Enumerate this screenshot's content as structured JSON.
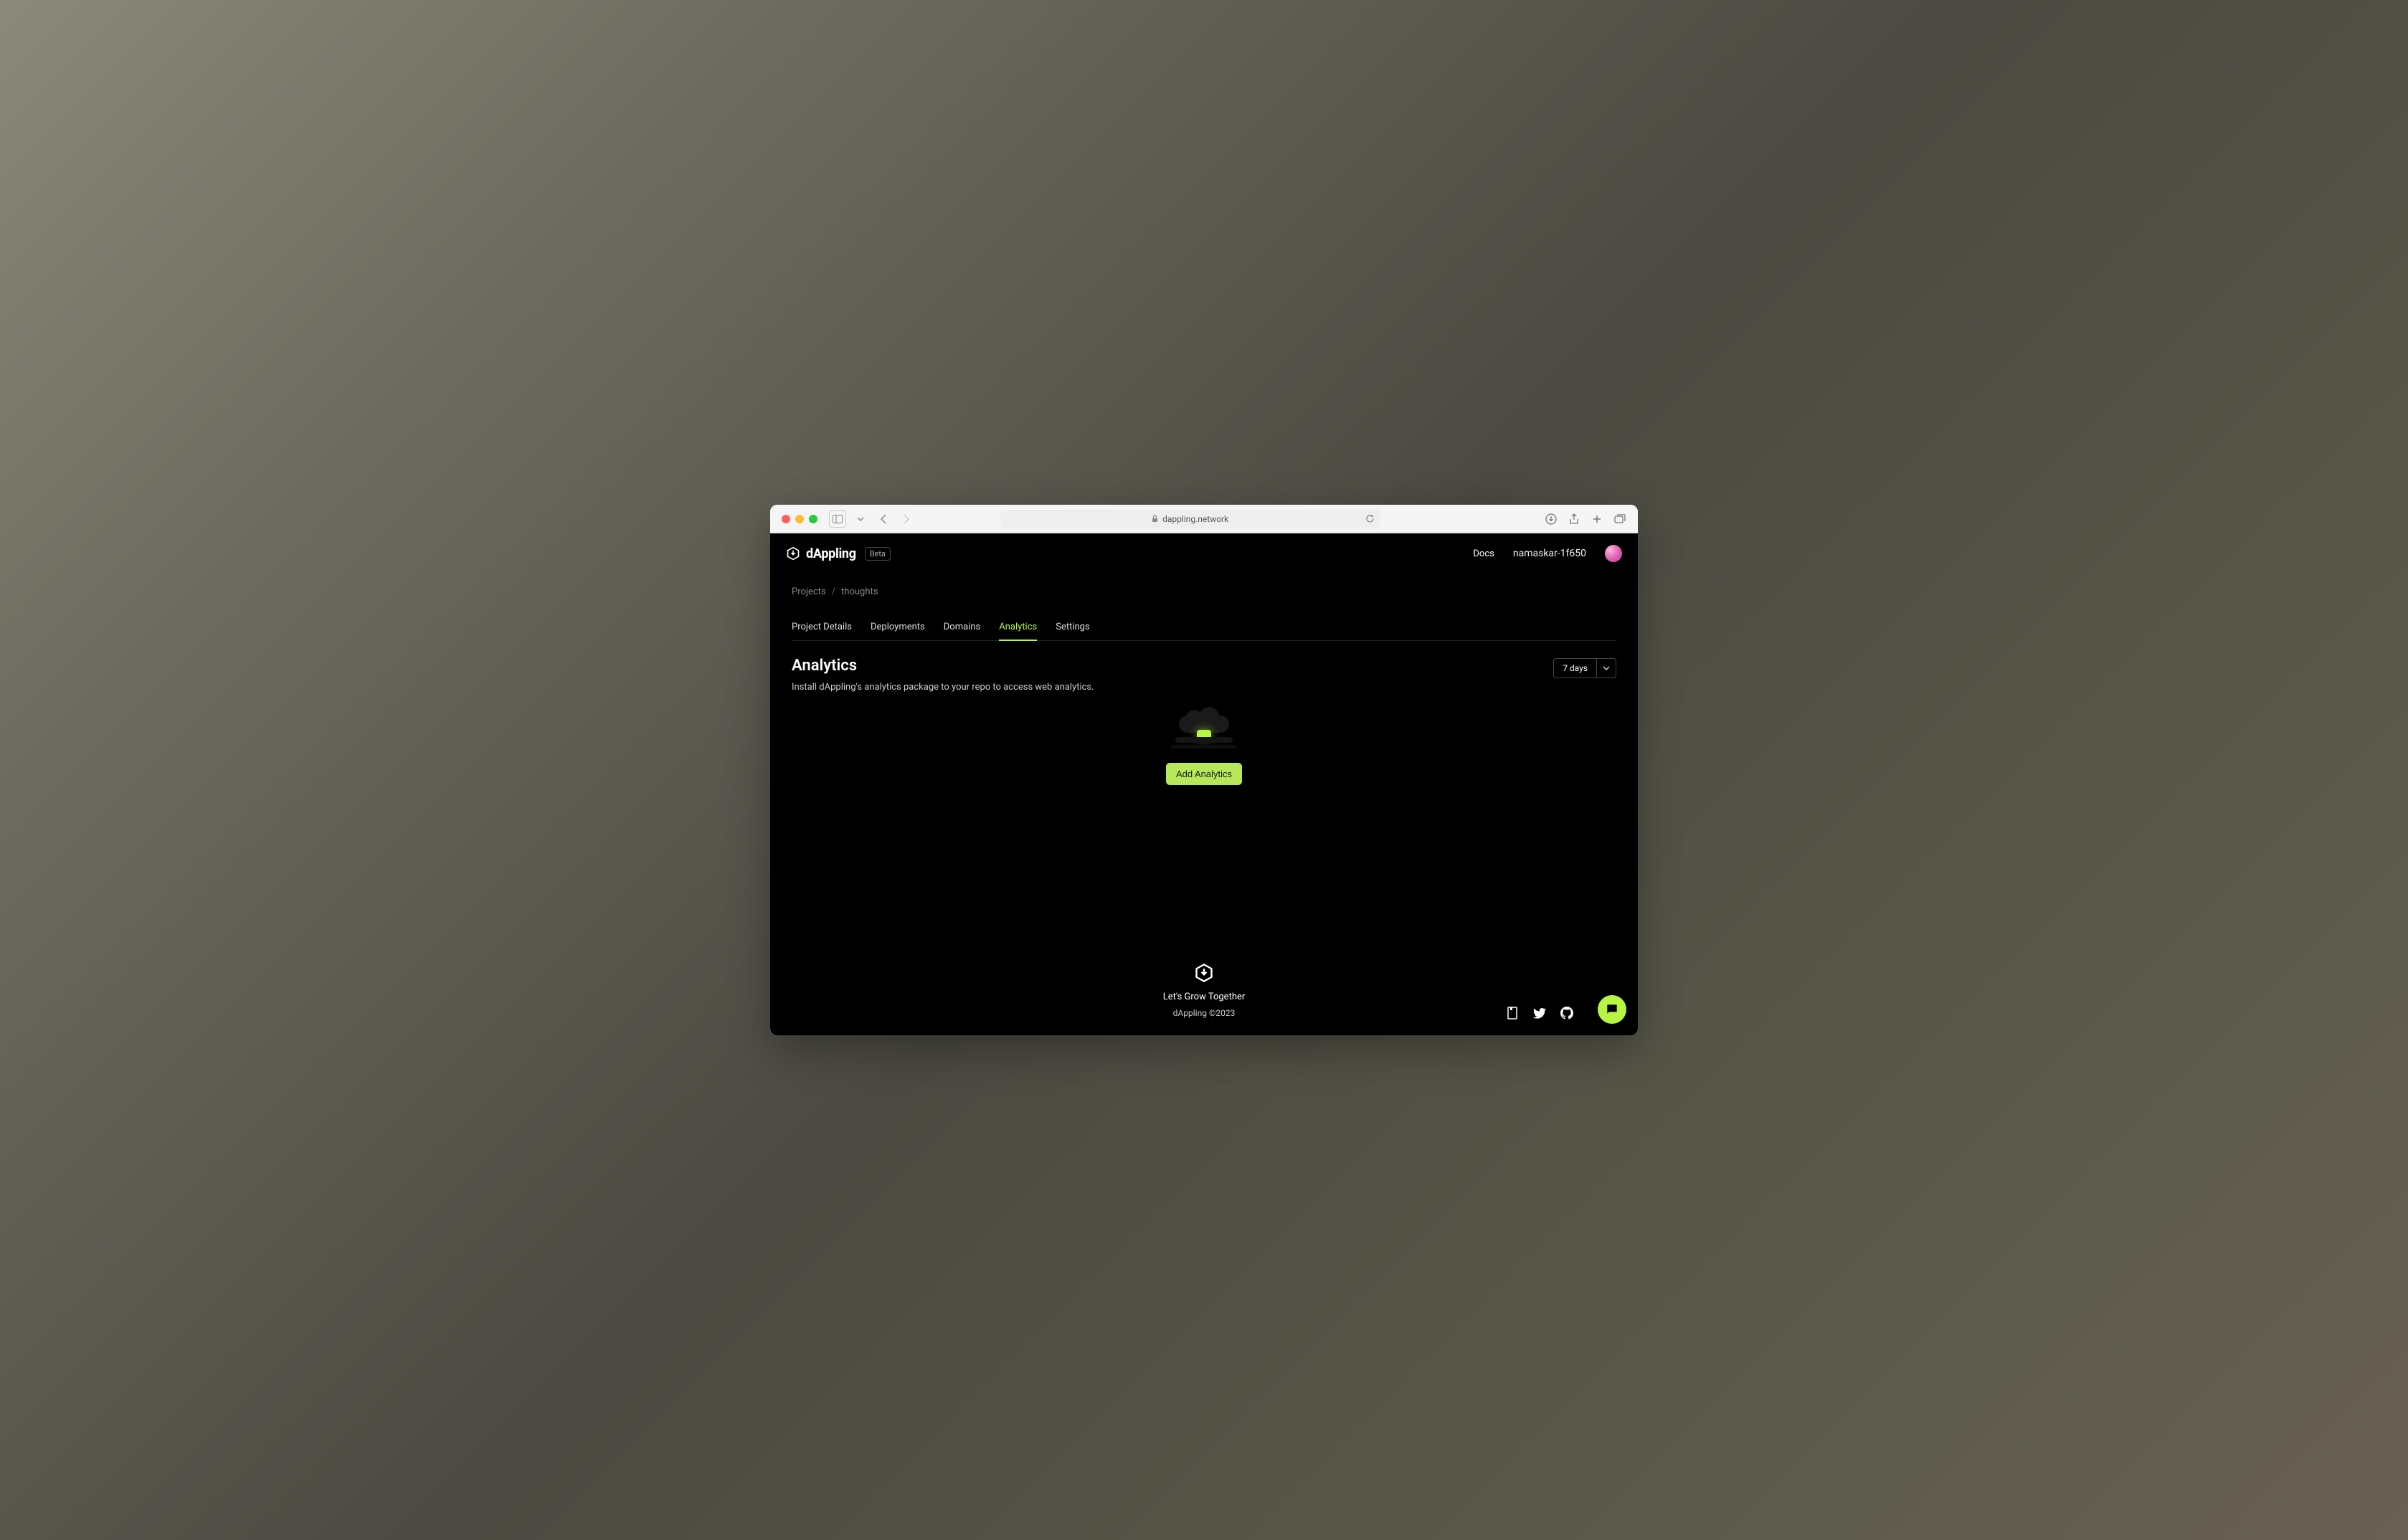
{
  "browser": {
    "url": "dappling.network"
  },
  "header": {
    "brand": "dAppling",
    "badge": "Beta",
    "docs": "Docs",
    "username": "namaskar-1f650"
  },
  "breadcrumbs": {
    "items": [
      "Projects",
      "thoughts"
    ]
  },
  "tabs": {
    "items": [
      {
        "label": "Project Details",
        "active": false
      },
      {
        "label": "Deployments",
        "active": false
      },
      {
        "label": "Domains",
        "active": false
      },
      {
        "label": "Analytics",
        "active": true
      },
      {
        "label": "Settings",
        "active": false
      }
    ]
  },
  "page": {
    "title": "Analytics",
    "description": "Install dAppling's analytics package to your repo to access web analytics.",
    "range": "7 days",
    "cta": "Add Analytics"
  },
  "footer": {
    "tagline": "Let's Grow Together",
    "copyright": "dAppling ©2023"
  },
  "colors": {
    "accent": "#b6f542",
    "bg": "#000000"
  }
}
